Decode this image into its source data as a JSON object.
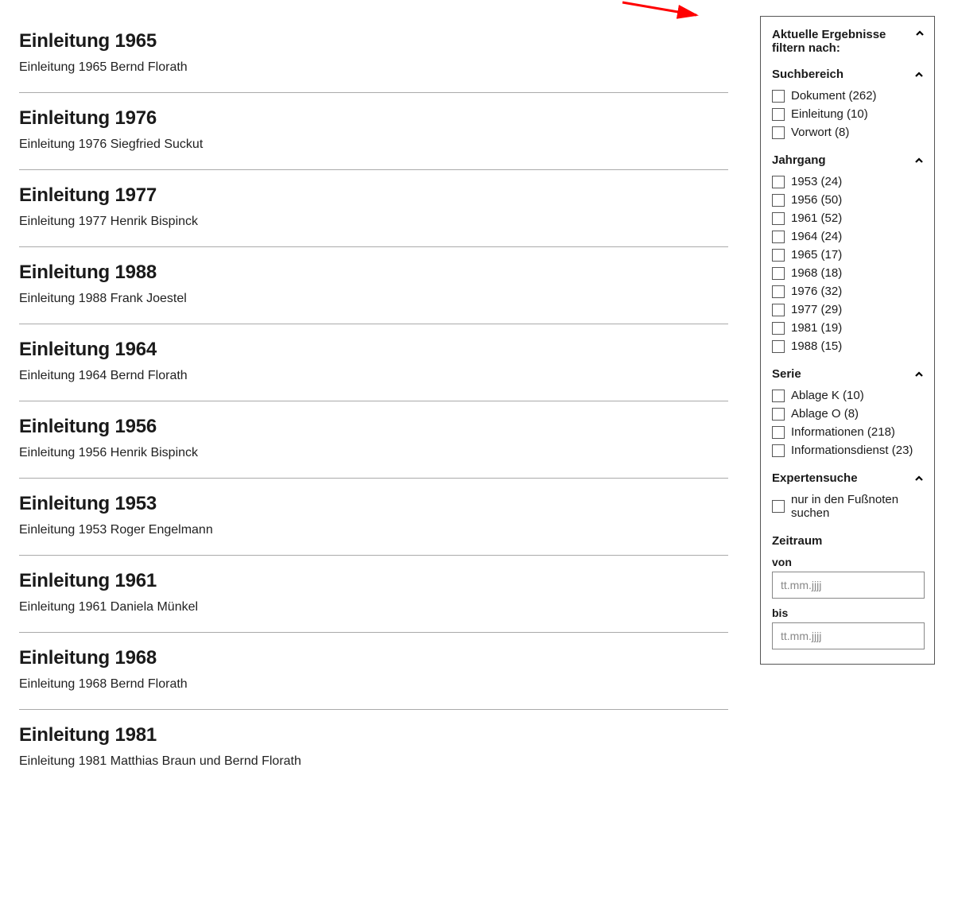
{
  "results": [
    {
      "title": "Einleitung 1965",
      "desc": "Einleitung 1965 Bernd Florath"
    },
    {
      "title": "Einleitung 1976",
      "desc": "Einleitung 1976 Siegfried Suckut"
    },
    {
      "title": "Einleitung 1977",
      "desc": "Einleitung 1977 Henrik Bispinck"
    },
    {
      "title": "Einleitung 1988",
      "desc": "Einleitung 1988 Frank Joestel"
    },
    {
      "title": "Einleitung 1964",
      "desc": "Einleitung 1964 Bernd Florath"
    },
    {
      "title": "Einleitung 1956",
      "desc": "Einleitung 1956 Henrik Bispinck"
    },
    {
      "title": "Einleitung 1953",
      "desc": "Einleitung 1953 Roger Engelmann"
    },
    {
      "title": "Einleitung 1961",
      "desc": "Einleitung 1961 Daniela Münkel"
    },
    {
      "title": "Einleitung 1968",
      "desc": "Einleitung 1968 Bernd Florath"
    },
    {
      "title": "Einleitung 1981",
      "desc": "Einleitung 1981 Matthias Braun und Bernd Florath"
    }
  ],
  "filter": {
    "title": "Aktuelle Ergebnisse filtern nach:",
    "sections": {
      "suchbereich": {
        "label": "Suchbereich",
        "options": [
          "Dokument (262)",
          "Einleitung (10)",
          "Vorwort (8)"
        ]
      },
      "jahrgang": {
        "label": "Jahrgang",
        "options": [
          "1953 (24)",
          "1956 (50)",
          "1961 (52)",
          "1964 (24)",
          "1965 (17)",
          "1968 (18)",
          "1976 (32)",
          "1977 (29)",
          "1981 (19)",
          "1988 (15)"
        ]
      },
      "serie": {
        "label": "Serie",
        "options": [
          "Ablage K (10)",
          "Ablage O (8)",
          "Informationen (218)",
          "Informationsdienst (23)"
        ]
      },
      "experten": {
        "label": "Expertensuche",
        "options": [
          "nur in den Fußnoten suchen"
        ]
      }
    },
    "zeitraum": {
      "label": "Zeitraum",
      "von_label": "von",
      "bis_label": "bis",
      "placeholder": "tt.mm.jjjj"
    }
  }
}
